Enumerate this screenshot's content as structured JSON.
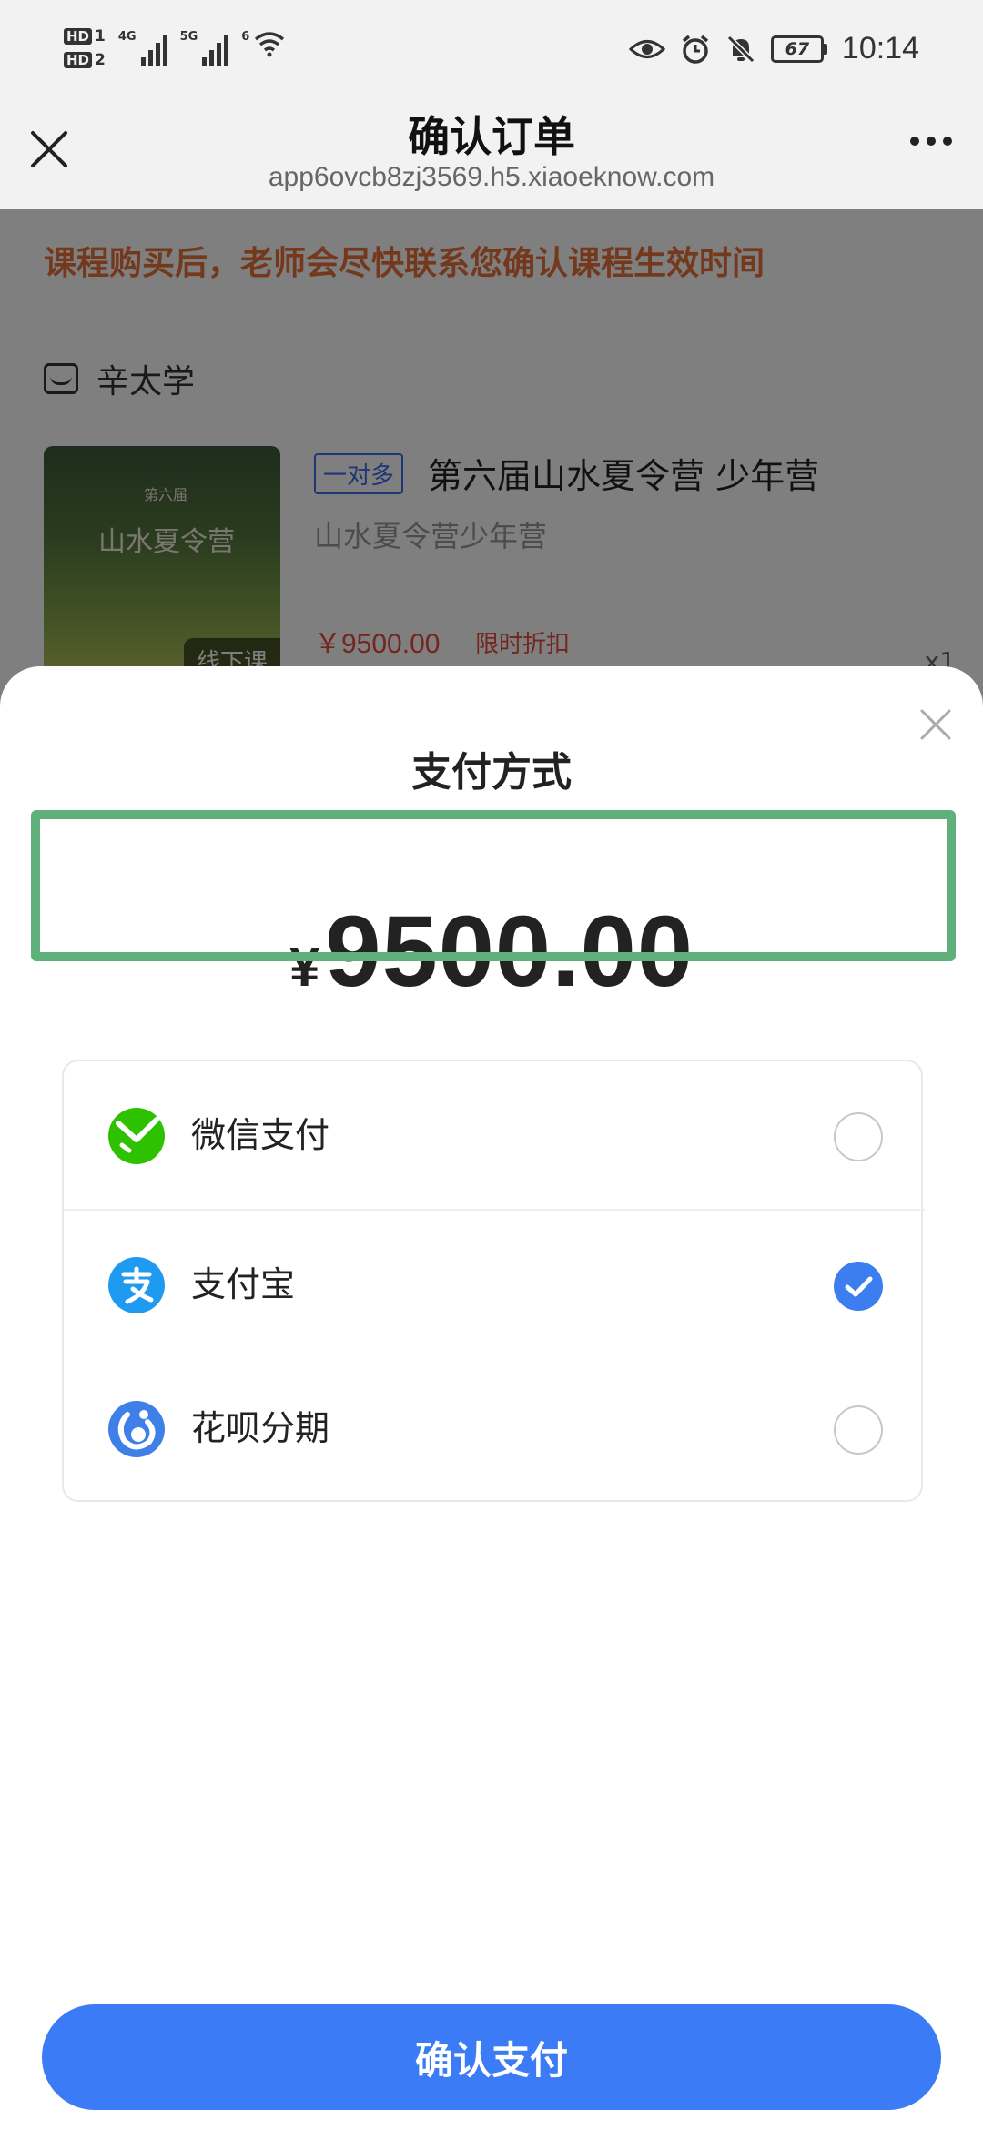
{
  "status_bar": {
    "hd1": "HD",
    "hd1_num": "1",
    "hd2": "HD",
    "hd2_num": "2",
    "net1": "4G",
    "net2": "5G",
    "wifi_num": "6",
    "battery": "67",
    "time": "10:14",
    "icons": [
      "eye-icon",
      "alarm-icon",
      "bell-off-icon"
    ]
  },
  "title_bar": {
    "title": "确认订单",
    "url": "app6ovcb8zj3569.h5.xiaoeknow.com"
  },
  "background_page": {
    "notice": "课程购买后，老师会尽快联系您确认课程生效时间",
    "shop_name": "辛太学",
    "product": {
      "thumb_small": "第六届",
      "thumb_title": "山水夏令营",
      "thumb_tag": "线下课",
      "tag": "一对多",
      "name": "第六届山水夏令营 少年营",
      "subtitle": "山水夏令营少年营",
      "price": "￥9500.00",
      "discount": "限时折扣",
      "quantity": "x1"
    }
  },
  "payment_sheet": {
    "title": "支付方式",
    "currency": "¥",
    "amount": "9500.00",
    "methods": [
      {
        "label": "微信支付",
        "icon": "wechat-pay-icon",
        "selected": false
      },
      {
        "label": "支付宝",
        "icon": "alipay-icon",
        "selected": true
      },
      {
        "label": "花呗分期",
        "icon": "huabei-icon",
        "selected": false
      }
    ],
    "confirm_label": "确认支付"
  },
  "colors": {
    "accent": "#3b7bf5",
    "highlight": "#5fb07a",
    "notice": "#e8733a",
    "price": "#e84b3a",
    "wechat": "#2dc100",
    "alipay": "#1e9bf0"
  }
}
